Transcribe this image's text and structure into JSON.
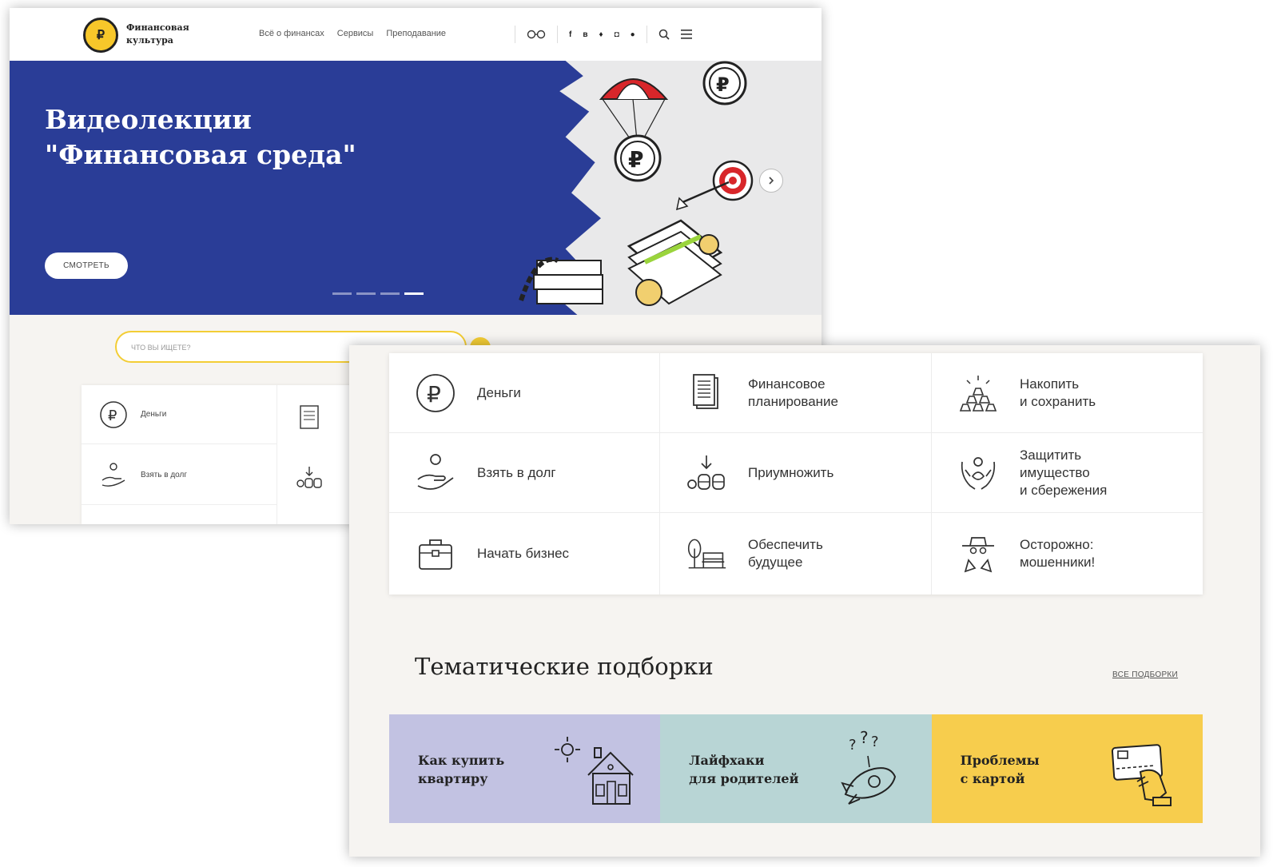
{
  "header": {
    "logo_symbol": "₽",
    "logo_title_line1": "Финансовая",
    "logo_title_line2": "культура",
    "nav": [
      "Всё о финансах",
      "Сервисы",
      "Преподавание"
    ],
    "social": [
      "f",
      "в",
      "♦",
      "◘",
      "●"
    ]
  },
  "hero": {
    "title_line1": "Видеолекции",
    "title_line2": "\"Финансовая среда\"",
    "button": "СМОТРЕТЬ",
    "slide_count": 4,
    "active_slide": 4,
    "colors": {
      "blue": "#2a3d97",
      "accent": "#f3cd35"
    }
  },
  "search": {
    "placeholder": "ЧТО ВЫ ИЩЕТЕ?"
  },
  "back_categories": [
    {
      "label": "Деньги",
      "icon": "ruble-coin-icon"
    },
    {
      "label": "Взять в долг",
      "icon": "hand-coin-icon"
    }
  ],
  "categories": [
    {
      "label": "Деньги",
      "icon": "ruble-coin-icon"
    },
    {
      "label": "Финансовое\nпланирование",
      "icon": "document-icon"
    },
    {
      "label": "Накопить\nи сохранить",
      "icon": "gold-bars-icon"
    },
    {
      "label": "Взять в долг",
      "icon": "hand-coin-icon"
    },
    {
      "label": "Приумножить",
      "icon": "coins-stack-icon"
    },
    {
      "label": "Защитить\nимущество\nи сбережения",
      "icon": "hands-protect-icon"
    },
    {
      "label": "Начать бизнес",
      "icon": "briefcase-icon"
    },
    {
      "label": "Обеспечить\nбудущее",
      "icon": "tree-bench-icon"
    },
    {
      "label": "Осторожно:\nмошенники!",
      "icon": "fraudster-icon"
    }
  ],
  "collections": {
    "title": "Тематические подборки",
    "all_link": "ВСЕ ПОДБОРКИ",
    "tiles": [
      {
        "title": "Как купить\nквартиру",
        "color": "#c2c2e2",
        "icon": "house-icon"
      },
      {
        "title": "Лайфхаки\nдля родителей",
        "color": "#b8d5d5",
        "icon": "rocket-icon"
      },
      {
        "title": "Проблемы\nс картой",
        "color": "#f7cd4d",
        "icon": "bank-card-icon"
      }
    ]
  }
}
